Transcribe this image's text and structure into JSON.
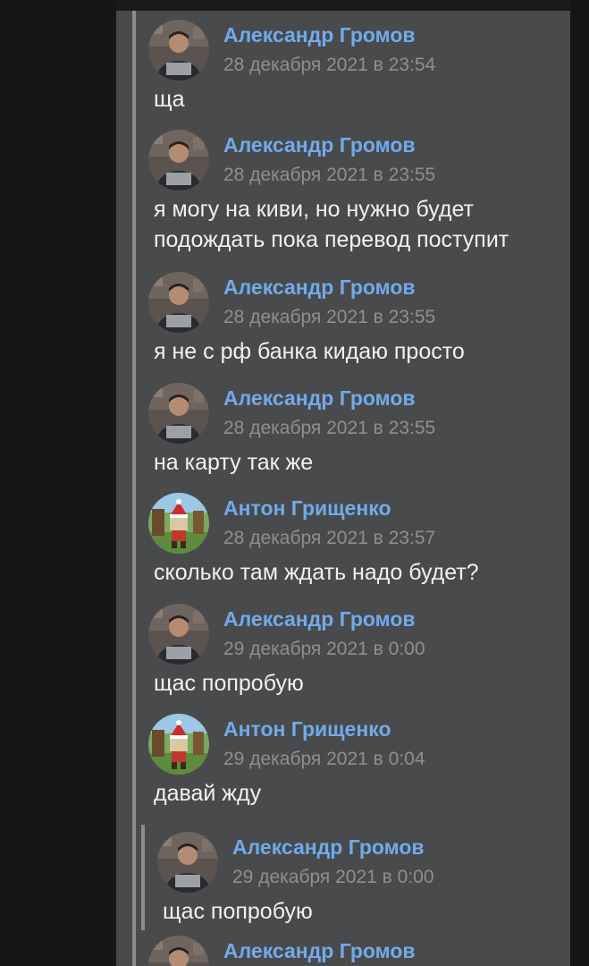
{
  "colors": {
    "author": "#71aaeb",
    "date": "#8d8f92",
    "text": "#f0f0f0",
    "panel": "#494a4b",
    "background": "#161616"
  },
  "messages": [
    {
      "author": "Александр Громов",
      "date": "28 декабря 2021 в 23:54",
      "text": "ща",
      "avatar": "alexander-avatar"
    },
    {
      "author": "Александр Громов",
      "date": "28 декабря 2021 в 23:55",
      "text": "я могу на киви, но нужно будет\nподождать пока перевод поступит",
      "avatar": "alexander-avatar"
    },
    {
      "author": "Александр Громов",
      "date": "28 декабря 2021 в 23:55",
      "text": "я не с рф банка кидаю просто",
      "avatar": "alexander-avatar"
    },
    {
      "author": "Александр Громов",
      "date": "28 декабря 2021 в 23:55",
      "text": "на карту так же",
      "avatar": "alexander-avatar"
    },
    {
      "author": "Антон Грищенко",
      "date": "28 декабря 2021 в 23:57",
      "text": "сколько там ждать надо будет?",
      "avatar": "anton-avatar"
    },
    {
      "author": "Александр Громов",
      "date": "29 декабря 2021 в 0:00",
      "text": "щас попробую",
      "avatar": "alexander-avatar"
    },
    {
      "author": "Антон Грищенко",
      "date": "29 декабря 2021 в 0:04",
      "text": "давай жду",
      "avatar": "anton-avatar"
    }
  ],
  "nested_quote": {
    "author": "Александр Громов",
    "date": "29 декабря 2021 в 0:00",
    "text": "щас попробую",
    "avatar": "alexander-avatar"
  },
  "trailing_message": {
    "author": "Александр Громов",
    "avatar": "alexander-avatar"
  }
}
